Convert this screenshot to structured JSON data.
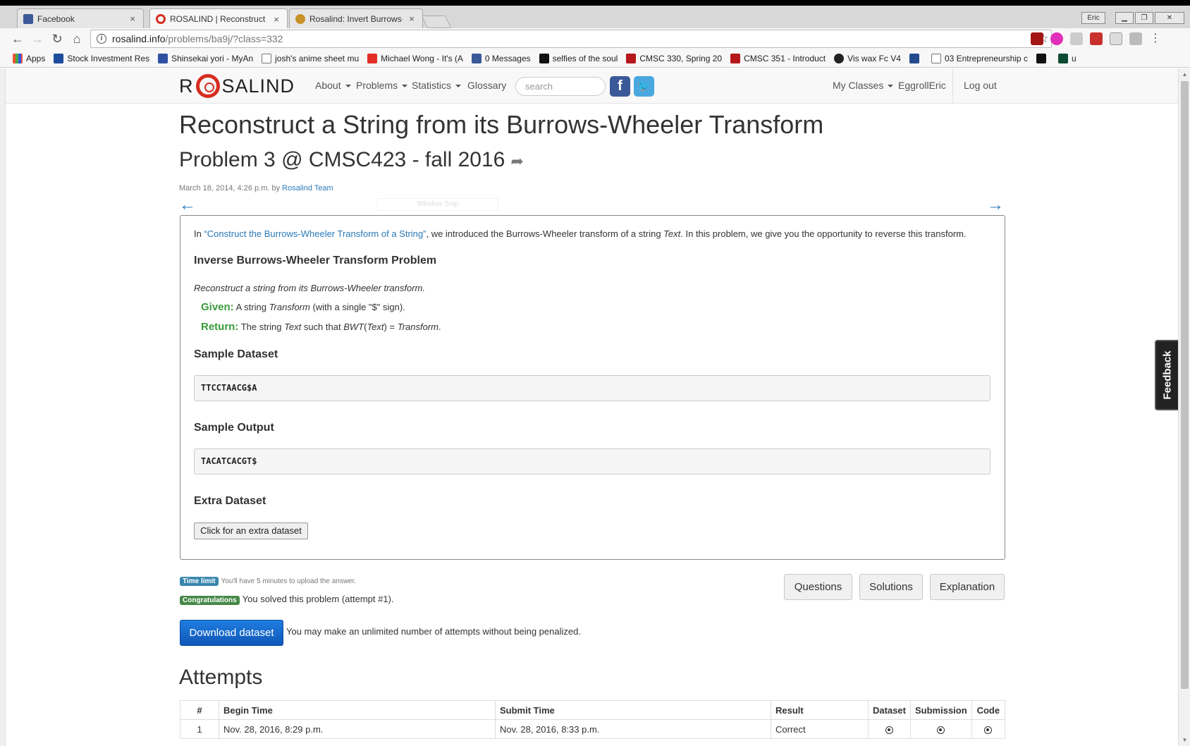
{
  "browser": {
    "tabs": [
      {
        "label": "Facebook",
        "close": "×"
      },
      {
        "label": "ROSALIND | Reconstruct",
        "close": "×"
      },
      {
        "label": "Rosalind: Invert Burrows-",
        "close": "×"
      }
    ],
    "window_user": "Eric",
    "url_host": "rosalind.info",
    "url_path": "/problems/ba9j/?class=332",
    "bookmarks": [
      "Apps",
      "Stock Investment Res",
      "Shinsekai yori - MyAn",
      "josh's anime sheet mu",
      "Michael Wong - It's (A",
      "0 Messages",
      "selfies of the soul",
      "CMSC 330, Spring 20",
      "CMSC 351 - Introduct",
      "Vis wax Fc V4",
      "03 Entrepreneurship c",
      "u"
    ]
  },
  "site": {
    "logo_left": "R",
    "logo_right": "SALIND",
    "nav": {
      "about": "About",
      "problems": "Problems",
      "statistics": "Statistics",
      "glossary": "Glossary"
    },
    "search_placeholder": "search",
    "my_classes": "My Classes",
    "user": "EggrollEric",
    "logout": "Log out"
  },
  "page": {
    "title": "Reconstruct a String from its Burrows-Wheeler Transform",
    "subtitle": "Problem 3 @ CMSC423 - fall 2016",
    "meta_prefix": "March 18, 2014, 4:26 p.m. by",
    "meta_author": "Rosalind Team",
    "prev_arrow": "←",
    "next_arrow": "→",
    "snip_text": "Window Snip",
    "intro_pre": "In ",
    "intro_link": "“Construct the Burrows-Wheeler Transform of a String”",
    "intro_mid": ", we introduced the Burrows-Wheeler transform of a string ",
    "intro_text_word": "Text",
    "intro_post": ". In this problem, we give you the opportunity to reverse this transform.",
    "problem_heading": "Inverse Burrows-Wheeler Transform Problem",
    "problem_statement": "Reconstruct a string from its Burrows-Wheeler transform.",
    "given_label": "Given:",
    "given_pre": " A string ",
    "given_word": "Transform",
    "given_post": " (with a single \"$\" sign).",
    "return_label": "Return:",
    "return_pre": " The string ",
    "return_text": "Text",
    "return_mid": " such that ",
    "return_bwt": "BWT",
    "return_paren": "(",
    "return_text2": "Text",
    "return_eq": ") = ",
    "return_transform": "Transform",
    "return_end": ".",
    "sample_dataset_heading": "Sample Dataset",
    "sample_dataset": "TTCCTAACG$A",
    "sample_output_heading": "Sample Output",
    "sample_output": "TACATCACGT$",
    "extra_heading": "Extra Dataset",
    "extra_button": "Click for an extra dataset",
    "time_limit_badge": "Time limit",
    "time_limit_text": "You'll have 5 minutes to upload the answer.",
    "congrats_badge": "Congratulations",
    "congrats_text": "You solved this problem (attempt #1).",
    "questions_button": "Questions",
    "solutions_button": "Solutions",
    "explanation_button": "Explanation",
    "download_button": "Download dataset",
    "download_note": "You may make an unlimited number of attempts without being penalized.",
    "attempts_heading": "Attempts",
    "feedback": "Feedback"
  },
  "attempts": {
    "headers": [
      "#",
      "Begin Time",
      "Submit Time",
      "Result",
      "Dataset",
      "Submission",
      "Code"
    ],
    "rows": [
      {
        "num": "1",
        "begin": "Nov. 28, 2016, 8:29 p.m.",
        "submit": "Nov. 28, 2016, 8:33 p.m.",
        "result": "Correct"
      }
    ]
  },
  "colors": {
    "link": "#2a7ab8",
    "green": "#3b9b3b",
    "primary": "#1a6dd0",
    "logo_red": "#d62d20"
  }
}
